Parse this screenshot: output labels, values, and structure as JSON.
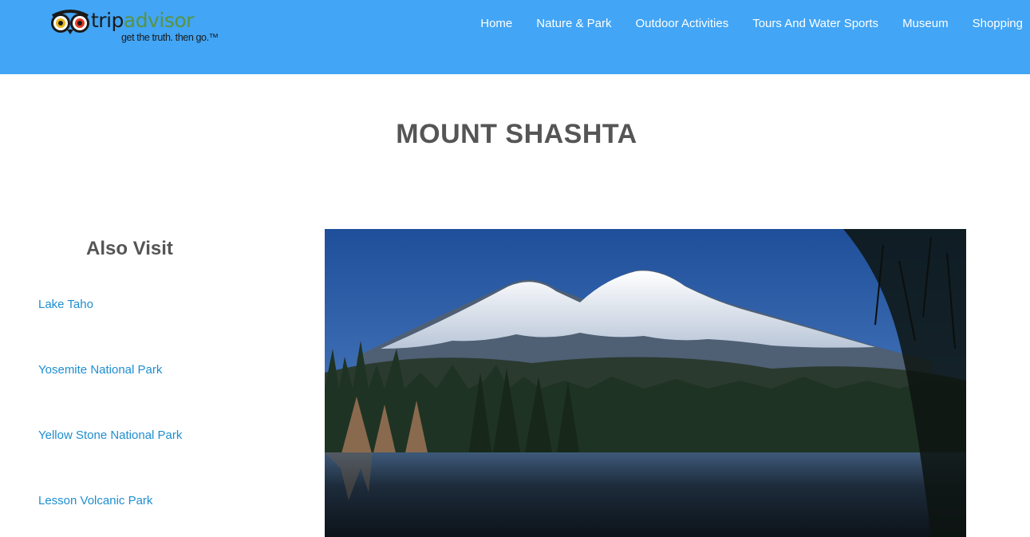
{
  "header": {
    "brand_name_part1": "trip",
    "brand_name_part2": "advisor",
    "brand_tagline": "get the truth. then go.™",
    "background_color": "#42a5f5",
    "nav": [
      {
        "label": "Home"
      },
      {
        "label": "Nature & Park"
      },
      {
        "label": "Outdoor Activities"
      },
      {
        "label": "Tours And Water Sports"
      },
      {
        "label": "Museum"
      },
      {
        "label": "Shopping"
      }
    ]
  },
  "main": {
    "title": "MOUNT SHASHTA",
    "sidebar": {
      "heading": "Also Visit",
      "link_color": "#1e8ed1",
      "links": [
        {
          "label": "Lake Taho"
        },
        {
          "label": "Yosemite National Park"
        },
        {
          "label": "Yellow Stone National Park"
        },
        {
          "label": "Lesson Volcanic Park"
        }
      ]
    },
    "image": {
      "icon": "mountain-lake-photo"
    }
  }
}
